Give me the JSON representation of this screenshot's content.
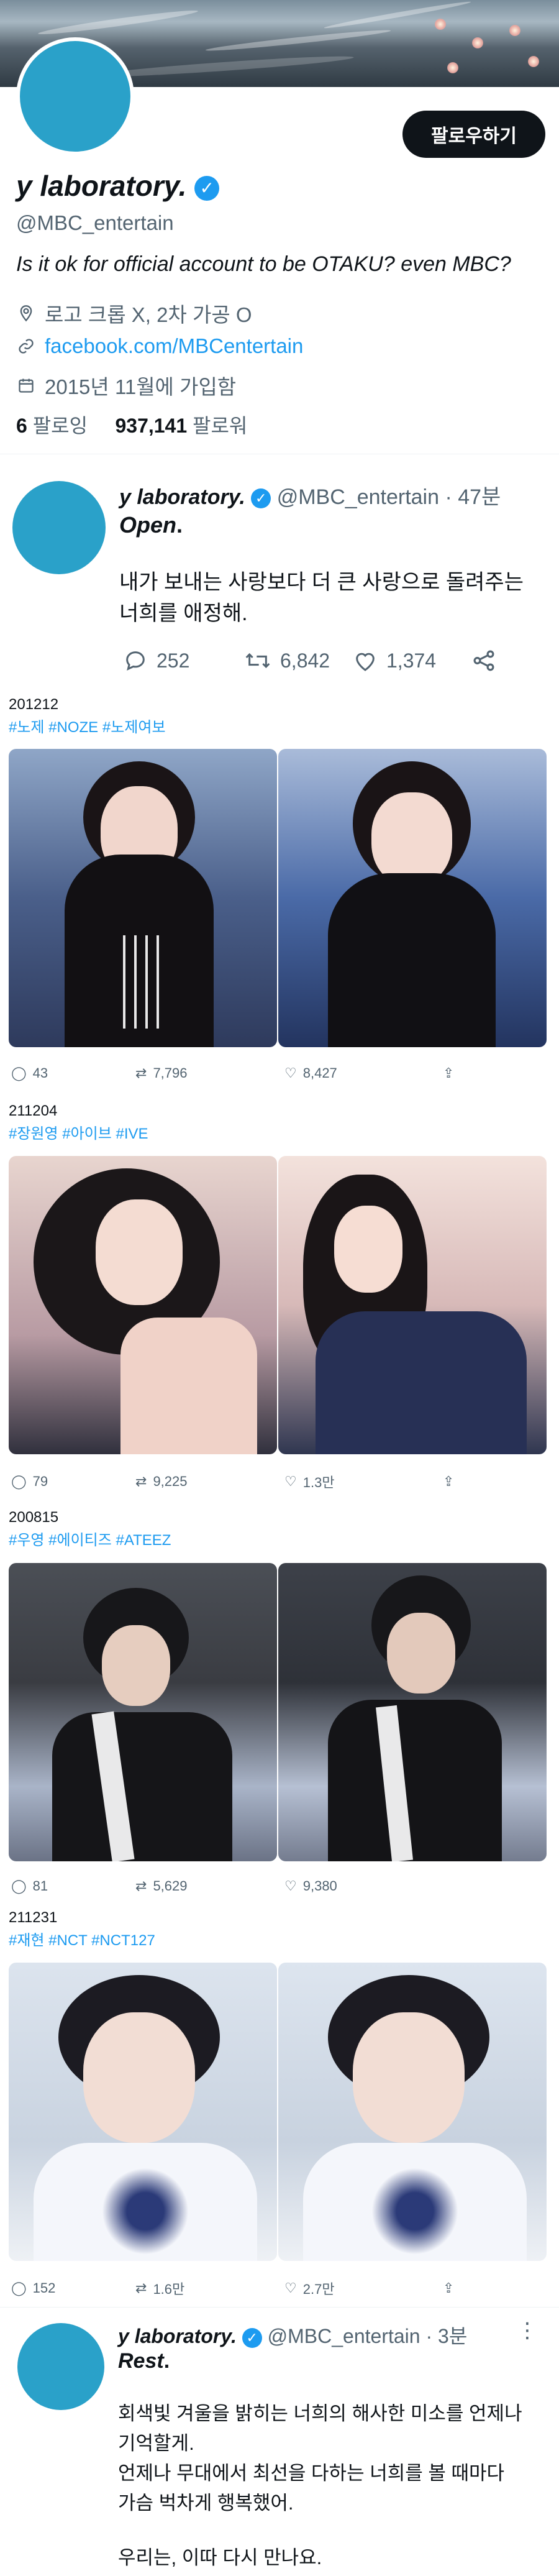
{
  "profile": {
    "name": "y laboratory.",
    "handle": "@MBC_entertain",
    "follow_button": "팔로우하기",
    "bio": "Is it ok for official account to be OTAKU? even MBC?",
    "location": "로고 크롭 X, 2차 가공 O",
    "website": "facebook.com/MBCentertain",
    "joined": "2015년 11월에 가입함",
    "following_count": "6",
    "following_label": "팔로잉",
    "followers_count": "937,141",
    "followers_label": "팔로워",
    "colors": {
      "avatar": "#2aa1c9",
      "verified": "#1d9bf0",
      "link": "#1d9bf0"
    }
  },
  "tweet1": {
    "name": "y laboratory.",
    "handle": "@MBC_entertain",
    "time": "· 47분",
    "title": "Open",
    "title_suffix": ".",
    "body_line1": "내가 보내는 사랑보다 더 큰 사랑으로 돌려주는",
    "body_line2": "너희를 애정해.",
    "replies": "252",
    "retweets": "6,842",
    "likes": "1,374"
  },
  "embeds": [
    {
      "date": "201212",
      "tags": "#노제 #NOZE #노제여보",
      "replies": "43",
      "retweets": "7,796",
      "likes": "8,427"
    },
    {
      "date": "211204",
      "tags": "#장원영 #아이브 #IVE",
      "replies": "79",
      "retweets": "9,225",
      "likes": "1.3만"
    },
    {
      "date": "200815",
      "tags": "#우영 #에이티즈 #ATEEZ",
      "replies": "81",
      "retweets": "5,629",
      "likes": "9,380"
    },
    {
      "date": "211231",
      "tags": "#재현 #NCT #NCT127",
      "replies": "152",
      "retweets": "1.6만",
      "likes": "2.7만"
    }
  ],
  "tweet2": {
    "name": "y laboratory.",
    "handle": "@MBC_entertain",
    "time": "· 3분",
    "title": "Rest",
    "title_suffix": ".",
    "body_line1": "회색빛 겨울을 밝히는 너희의 해사한 미소를 언제나",
    "body_line2": "기억할게.",
    "body_line3": "언제나 무대에서 최선을 다하는 너희를 볼 때마다",
    "body_line4": "가슴 벅차게 행복했어.",
    "body_line5": "우리는, 이따 다시 만나요."
  },
  "icons": [
    "location-icon",
    "link-icon",
    "calendar-icon",
    "reply-icon",
    "retweet-icon",
    "like-icon",
    "share-icon",
    "more-icon",
    "verified-icon"
  ]
}
